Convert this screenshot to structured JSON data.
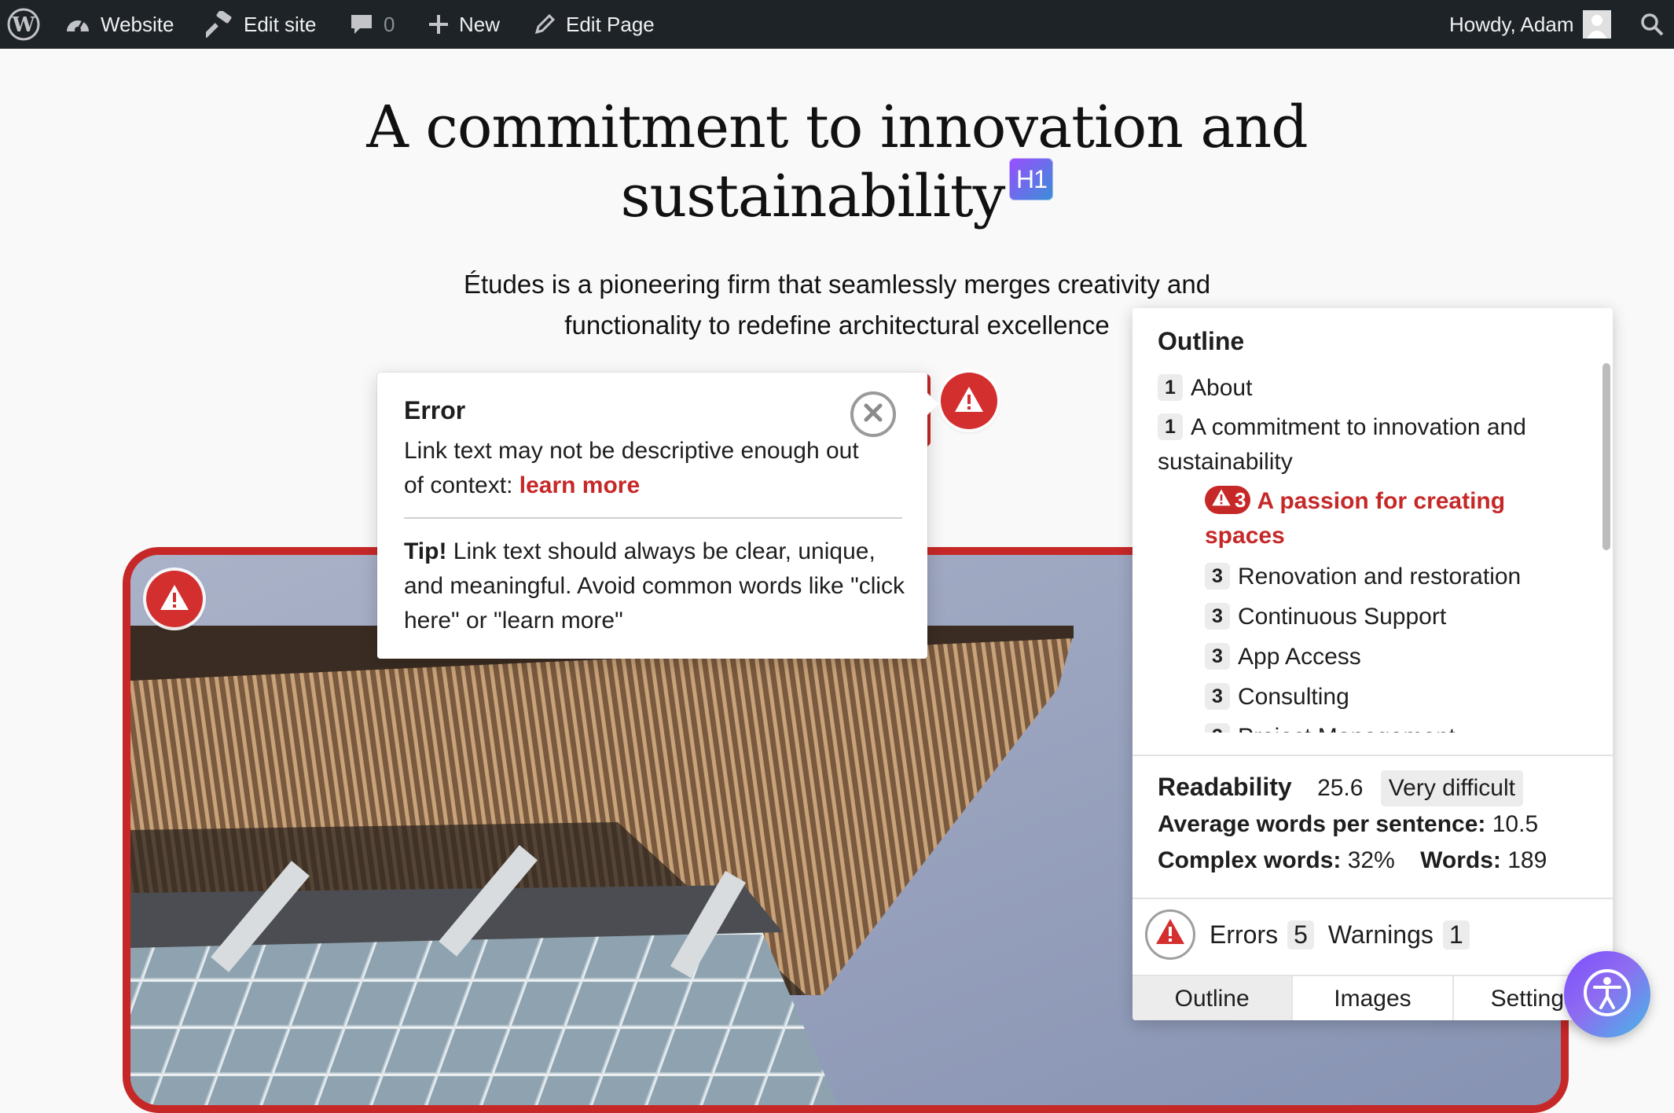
{
  "adminbar": {
    "site_label": "Website",
    "edit_site_label": "Edit site",
    "comments_count": "0",
    "new_label": "New",
    "edit_page_label": "Edit Page",
    "howdy": "Howdy, Adam"
  },
  "hero": {
    "title_line1": "A commitment to innovation and",
    "title_line2": "sustainability",
    "heading_badge": "H1",
    "subtitle_line1": "Études is a pioneering firm that seamlessly merges creativity and",
    "subtitle_line2": "functionality to redefine architectural excellence"
  },
  "error_popover": {
    "title": "Error",
    "body_prefix": "Link text may not be descriptive enough out of context:",
    "link_text": "learn more",
    "tip_label": "Tip!",
    "tip_text": "Link text should always be clear, unique, and meaningful. Avoid common words like \"click here\" or \"learn more\""
  },
  "panel": {
    "outline_title": "Outline",
    "items": [
      {
        "level": "1",
        "text": "About"
      },
      {
        "level": "1",
        "text_line1": "A commitment to innovation and",
        "text_line2": "sustainability"
      },
      {
        "level": "3",
        "text_line1": "A passion for creating",
        "text_line2": "spaces",
        "error": true
      },
      {
        "level": "3",
        "text": "Renovation and restoration"
      },
      {
        "level": "3",
        "text": "Continuous Support"
      },
      {
        "level": "3",
        "text": "App Access"
      },
      {
        "level": "3",
        "text": "Consulting"
      },
      {
        "level": "3",
        "text": "Project Management"
      }
    ],
    "readability": {
      "label": "Readability",
      "score": "25.6",
      "rating": "Very difficult",
      "avg_label": "Average words per sentence:",
      "avg_value": "10.5",
      "complex_label": "Complex words:",
      "complex_value": "32%",
      "words_label": "Words:",
      "words_value": "189"
    },
    "issues": {
      "errors_label": "Errors",
      "errors_count": "5",
      "warnings_label": "Warnings",
      "warnings_count": "1"
    },
    "tabs": [
      "Outline",
      "Images",
      "Settings"
    ],
    "active_tab": "Outline"
  },
  "colors": {
    "admin_bar": "#1d2327",
    "error_red": "#c62828",
    "page_bg": "#f9f9f9"
  },
  "icons": {
    "wp_logo": "wordpress-logo-icon",
    "dashboard": "dashboard-icon",
    "edit_site": "hammer-icon",
    "comments": "comment-icon",
    "new": "plus-icon",
    "edit_page": "pencil-icon",
    "avatar": "user-avatar-icon",
    "search": "search-icon",
    "warning": "warning-icon",
    "close": "close-icon",
    "accessibility": "accessibility-icon"
  }
}
